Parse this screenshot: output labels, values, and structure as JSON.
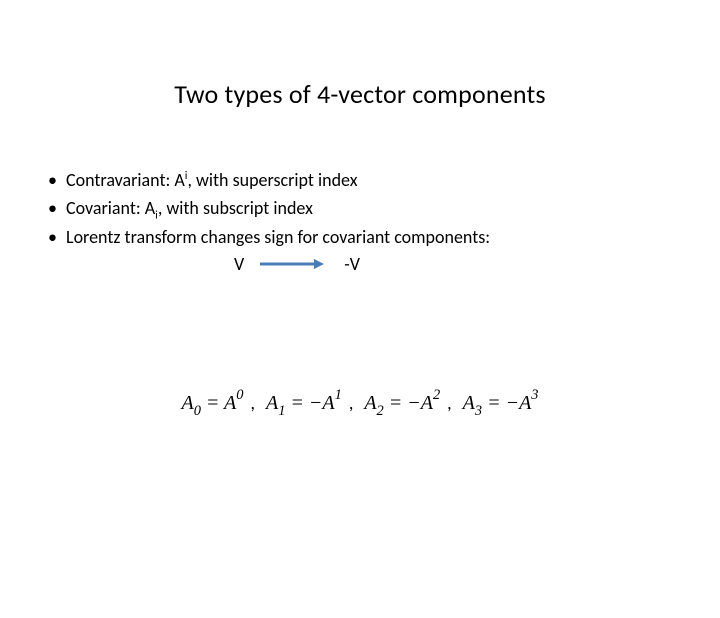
{
  "title": "Two types of 4-vector components",
  "bullets": {
    "b1_pre": "Contravariant: A",
    "b1_sup": "i",
    "b1_post": ", with superscript index",
    "b2_pre": "Covariant: A",
    "b2_sub": "i",
    "b2_post": ", with subscript index",
    "b3": "Lorentz transform changes sign for covariant components:"
  },
  "lorentz": {
    "left": "V",
    "right": "-V"
  },
  "equations": {
    "e0_lhs_base": "A",
    "e0_lhs_sub": "0",
    "e0_eq": " = ",
    "e0_rhs_base": "A",
    "e0_rhs_sup": "0",
    "c1": ",",
    "e1_lhs_base": "A",
    "e1_lhs_sub": "1",
    "e1_eq": " = −",
    "e1_rhs_base": "A",
    "e1_rhs_sup": "1",
    "c2": ",",
    "e2_lhs_base": "A",
    "e2_lhs_sub": "2",
    "e2_eq": " = −",
    "e2_rhs_base": "A",
    "e2_rhs_sup": "2",
    "c3": ",",
    "e3_lhs_base": "A",
    "e3_lhs_sub": "3",
    "e3_eq": " = −",
    "e3_rhs_base": "A",
    "e3_rhs_sup": "3"
  }
}
